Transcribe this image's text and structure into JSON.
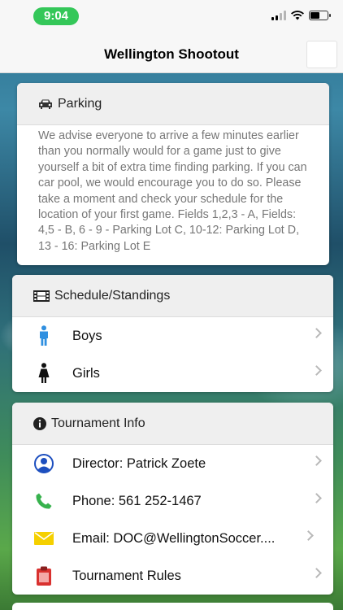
{
  "status_bar": {
    "time": "9:04"
  },
  "nav": {
    "title": "Wellington Shootout"
  },
  "parking": {
    "title": "Parking",
    "body": "We advise everyone to arrive a few minutes earlier than you normally would for a game just to give yourself a bit of extra time finding parking. If you can car pool, we would encourage you to do so. Please take a moment and check your schedule for the location of your first game. Fields 1,2,3 - A, Fields: 4,5 - B, 6 - 9 - Parking Lot C, 10-12: Parking Lot D, 13 - 16: Parking Lot E"
  },
  "schedule": {
    "title": "Schedule/Standings",
    "items": [
      {
        "label": "Boys",
        "icon": "male-icon"
      },
      {
        "label": "Girls",
        "icon": "female-icon"
      }
    ]
  },
  "tournament": {
    "title": "Tournament Info",
    "items": [
      {
        "label": "Director: Patrick Zoete",
        "icon": "person-icon"
      },
      {
        "label": "Phone: 561 252-1467",
        "icon": "phone-icon"
      },
      {
        "label": "Email: DOC@WellingtonSoccer....",
        "icon": "mail-icon"
      },
      {
        "label": "Tournament Rules",
        "icon": "clipboard-icon"
      }
    ]
  },
  "colors": {
    "status_green": "#34c759",
    "boys_blue": "#2f8fe0",
    "phone_green": "#37b24d",
    "mail_yellow": "#f5d000",
    "rules_red": "#d9312f",
    "director_blue": "#1d4fbf"
  }
}
